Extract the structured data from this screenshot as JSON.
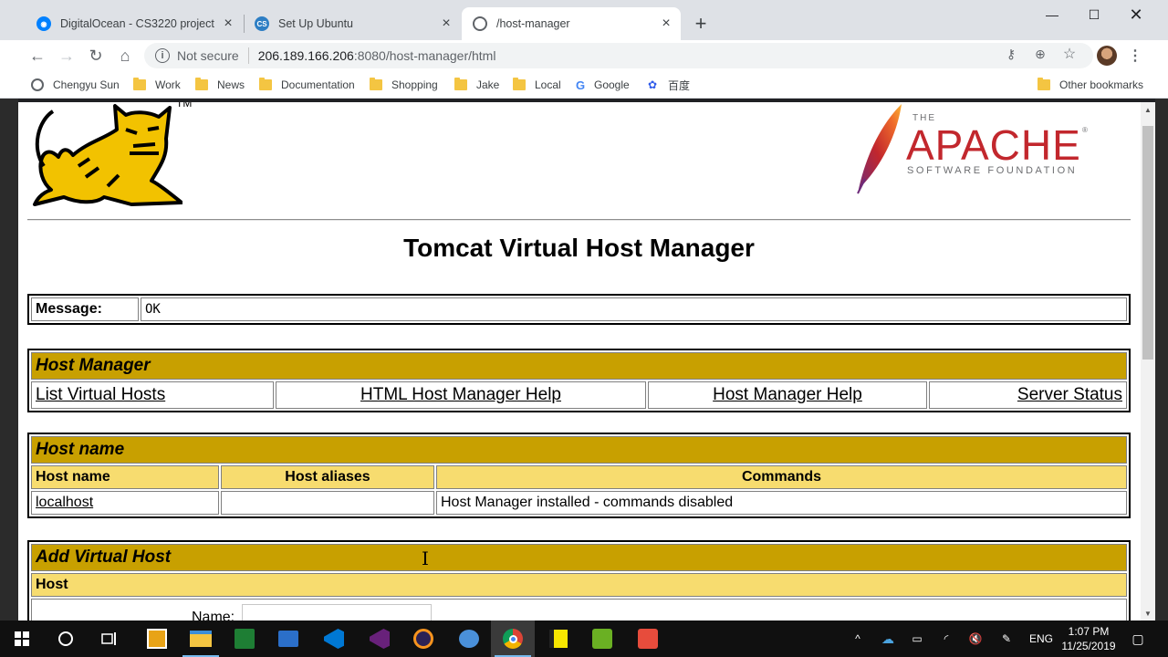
{
  "browser": {
    "tabs": [
      {
        "label": "DigitalOcean - CS3220 project",
        "icon": "digitalocean-icon",
        "color": "#0080ff"
      },
      {
        "label": "Set Up Ubuntu",
        "icon": "cs-icon",
        "color": "#2d7ec4"
      },
      {
        "label": "/host-manager",
        "icon": "globe-icon",
        "color": "#5f6368"
      }
    ],
    "active_tab": 2,
    "url": {
      "security": "Not secure",
      "host": "206.189.166.206",
      "path": ":8080/host-manager/html"
    },
    "bookmarks": [
      {
        "label": "Chengyu Sun",
        "icon": "globe-icon"
      },
      {
        "label": "Work",
        "icon": "folder-icon"
      },
      {
        "label": "News",
        "icon": "folder-icon"
      },
      {
        "label": "Documentation",
        "icon": "folder-icon"
      },
      {
        "label": "Shopping",
        "icon": "folder-icon"
      },
      {
        "label": "Jake",
        "icon": "folder-icon"
      },
      {
        "label": "Local",
        "icon": "folder-icon"
      },
      {
        "label": "Google",
        "icon": "google-icon"
      },
      {
        "label": "百度",
        "icon": "baidu-icon"
      }
    ],
    "other_bookmarks": "Other bookmarks"
  },
  "page": {
    "tm": "TM",
    "apache": {
      "the": "THE",
      "word": "APACHE",
      "sub": "SOFTWARE FOUNDATION"
    },
    "title": "Tomcat Virtual Host Manager",
    "message": {
      "label": "Message:",
      "value": "OK"
    },
    "host_manager": {
      "heading": "Host Manager",
      "links": [
        "List Virtual Hosts",
        "HTML Host Manager Help",
        "Host Manager Help",
        "Server Status"
      ]
    },
    "host_table": {
      "heading": "Host name",
      "columns": [
        "Host name",
        "Host aliases",
        "Commands"
      ],
      "rows": [
        {
          "name": "localhost",
          "aliases": "",
          "commands": "Host Manager installed - commands disabled"
        }
      ]
    },
    "add_host": {
      "heading": "Add Virtual Host",
      "subheading": "Host",
      "name_label": "Name:",
      "name_value": ""
    }
  },
  "taskbar": {
    "language": "ENG",
    "time": "1:07 PM",
    "date": "11/25/2019"
  },
  "colors": {
    "tomcat_header": "#c8a000",
    "tomcat_subheader": "#f7dc6f",
    "apache_red": "#c2272d"
  }
}
